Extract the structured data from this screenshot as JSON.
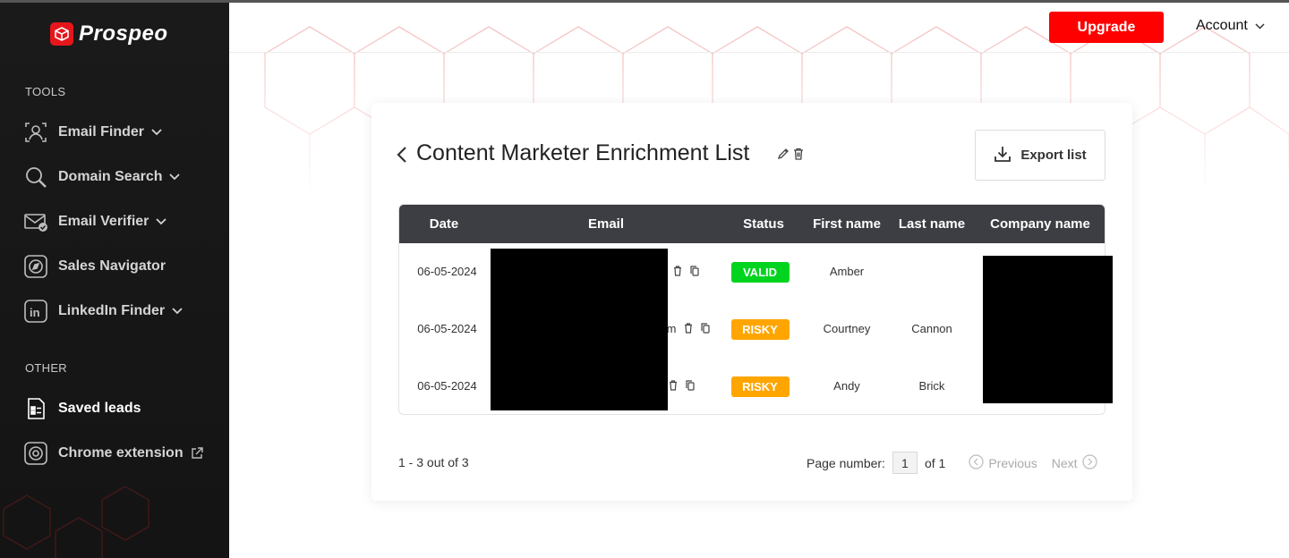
{
  "brand": {
    "name": "Prospeo",
    "color": "#e6161c"
  },
  "sidebar": {
    "sections": [
      {
        "label": "TOOLS"
      },
      {
        "label": "OTHER"
      }
    ],
    "items": [
      {
        "label": "Email Finder",
        "icon": "user-frame-icon",
        "dropdown": true
      },
      {
        "label": "Domain Search",
        "icon": "magnifier-icon",
        "dropdown": true
      },
      {
        "label": "Email Verifier",
        "icon": "envelope-check-icon",
        "dropdown": true
      },
      {
        "label": "Sales Navigator",
        "icon": "compass-icon",
        "dropdown": false
      },
      {
        "label": "LinkedIn Finder",
        "icon": "linkedin-icon",
        "dropdown": true
      },
      {
        "label": "Saved leads",
        "icon": "saved-list-icon",
        "active": true
      },
      {
        "label": "Chrome extension",
        "icon": "chrome-icon",
        "external": true
      }
    ]
  },
  "header": {
    "upgrade_label": "Upgrade",
    "account_label": "Account",
    "upgrade_color": "#ff0000"
  },
  "list": {
    "title": "Content Marketer Enrichment List",
    "export_label": "Export list"
  },
  "table": {
    "columns": [
      "Date",
      "Email",
      "Status",
      "First name",
      "Last name",
      "Company name"
    ],
    "rows": [
      {
        "date": "06-05-2024",
        "email_tail": "",
        "status": "VALID",
        "first_name": "Amber",
        "last_name": "",
        "company": ""
      },
      {
        "date": "06-05-2024",
        "email_tail": "m",
        "status": "RISKY",
        "first_name": "Courtney",
        "last_name": "Cannon",
        "company": ""
      },
      {
        "date": "06-05-2024",
        "email_tail": "",
        "status": "RISKY",
        "first_name": "Andy",
        "last_name": "Brick",
        "company": ""
      }
    ],
    "status_colors": {
      "VALID": "#00d41f",
      "RISKY": "#ffa500"
    }
  },
  "pagination": {
    "count_text": "1 - 3 out of 3",
    "page_label": "Page number:",
    "page_value": "1",
    "of_text": "of 1",
    "previous_label": "Previous",
    "next_label": "Next"
  }
}
